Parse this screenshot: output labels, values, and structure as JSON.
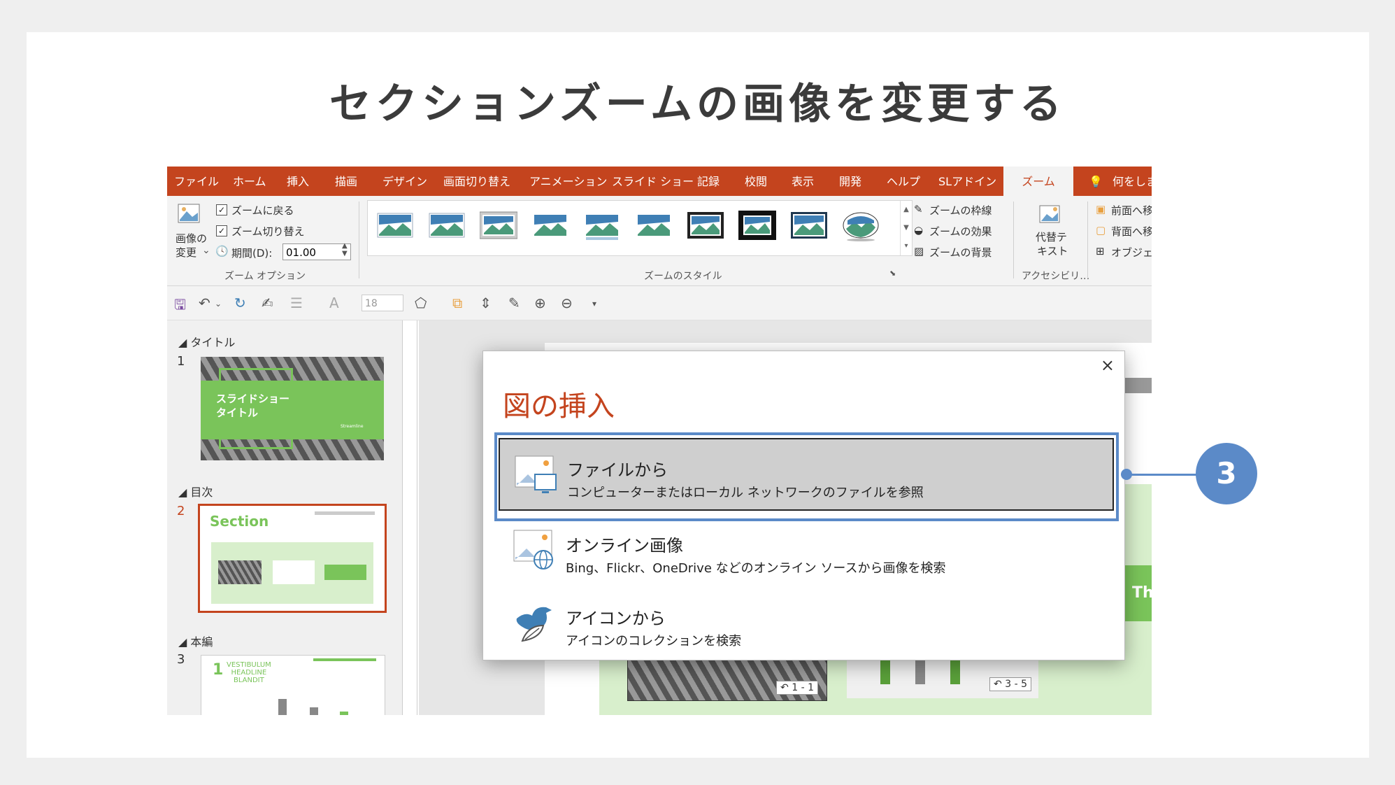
{
  "page": {
    "title": "セクションズームの画像を変更する"
  },
  "ribbon_tabs": [
    "ファイル",
    "ホーム",
    "挿入",
    "描画",
    "デザイン",
    "画面切り替え",
    "アニメーション",
    "スライド ショー",
    "記録",
    "校閲",
    "表示",
    "開発",
    "ヘルプ",
    "SLアドイン",
    "ズーム",
    "何をしま"
  ],
  "active_tab": "ズーム",
  "zoom_options": {
    "change_image_line1": "画像の",
    "change_image_line2": "変更",
    "return_to_zoom": "ズームに戻る",
    "zoom_transition": "ズーム切り替え",
    "duration_label": "期間(D):",
    "duration_value": "01.00",
    "group_label": "ズーム オプション"
  },
  "zoom_styles": {
    "border": "ズームの枠線",
    "effects": "ズームの効果",
    "background": "ズームの背景",
    "group_label": "ズームのスタイル"
  },
  "accessibility": {
    "alt_text_line1": "代替テ",
    "alt_text_line2": "キスト",
    "group_label": "アクセシビリ…"
  },
  "arrange": {
    "bring_forward": "前面へ移",
    "send_backward": "背面へ移",
    "objects": "オブジェク"
  },
  "qat": {
    "font_size": "18"
  },
  "sections": [
    {
      "name": "タイトル",
      "slide_number": "1"
    },
    {
      "name": "目次",
      "slide_number": "2"
    },
    {
      "name": "本編",
      "slide_number": "3"
    }
  ],
  "slide1": {
    "title": "スライドショー\nタイトル",
    "brand": "Streamline"
  },
  "slide2": {
    "title": "Section"
  },
  "slide3": {
    "number": "1",
    "text": "VESTIBULUM\nHEADLINE\nBLANDIT"
  },
  "zoom_badges": {
    "first": "1 - 1",
    "second": "3 - 5"
  },
  "slide_text_fragment": "Th",
  "dialog": {
    "title": "図の挿入",
    "close": "×",
    "options": [
      {
        "title": "ファイルから",
        "desc": "コンピューターまたはローカル ネットワークのファイルを参照"
      },
      {
        "title": "オンライン画像",
        "desc": "Bing、Flickr、OneDrive などのオンライン ソースから画像を検索"
      },
      {
        "title": "アイコンから",
        "desc": "アイコンのコレクションを検索"
      }
    ]
  },
  "callout": {
    "number": "3"
  },
  "colors": {
    "accent": "#c4441e",
    "callout": "#5b8ac8",
    "green": "#7ac45a"
  }
}
